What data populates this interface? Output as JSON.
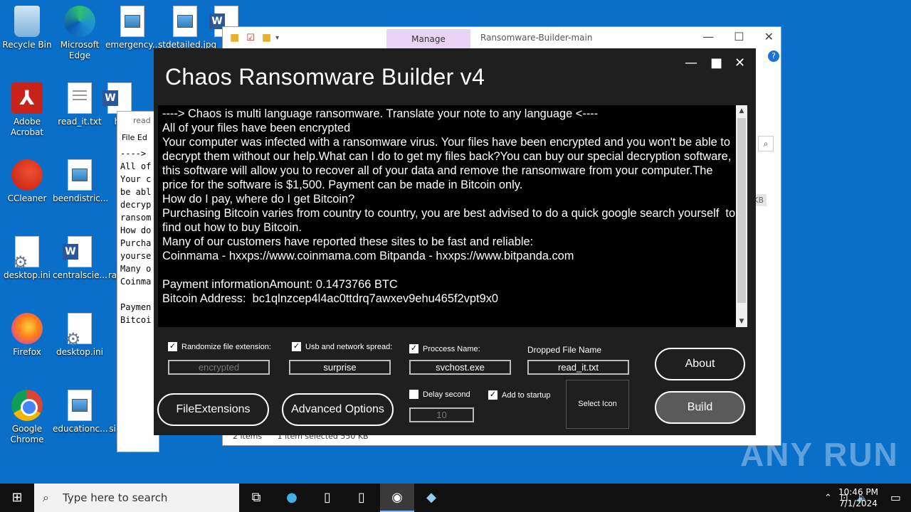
{
  "desktop": {
    "icons": [
      {
        "label": "Recycle Bin"
      },
      {
        "label": "Microsoft Edge"
      },
      {
        "label": "emergency..."
      },
      {
        "label": "stdetailed.jpg"
      },
      {
        "label": "Adobe Acrobat"
      },
      {
        "label": "read_it.txt"
      },
      {
        "label": "ha"
      },
      {
        "label": "CCleaner"
      },
      {
        "label": "beendistric..."
      },
      {
        "label": "desktop.ini"
      },
      {
        "label": "centralscie..."
      },
      {
        "label": "ra"
      },
      {
        "label": "Firefox"
      },
      {
        "label": "desktop.ini"
      },
      {
        "label": "Google Chrome"
      },
      {
        "label": "educationc..."
      },
      {
        "label": "si"
      }
    ]
  },
  "explorer": {
    "title": "Ransomware-Builder-main",
    "ribbon_tab": "Manage",
    "status_items": "2 items",
    "status_selected": "1 item selected  550 KB",
    "kb_label": "KB"
  },
  "notepad": {
    "title": "read",
    "menu": "File  Ed",
    "lines": "---->\nAll of\nYour c\nbe abl\ndecryp\nransom\nHow do\nPurcha\nyourse\nMany o\nCoinma\n\nPaymen\nBitcoi"
  },
  "chaos": {
    "title": "Chaos Ransomware Builder v4",
    "note": "----> Chaos is multi language ransomware. Translate your note to any language <----\nAll of your files have been encrypted\nYour computer was infected with a ransomware virus. Your files have been encrypted and you won't be able to decrypt them without our help.What can I do to get my files back?You can buy our special decryption software, this software will allow you to recover all of your data and remove the ransomware from your computer.The price for the software is $1,500. Payment can be made in Bitcoin only.\nHow do I pay, where do I get Bitcoin?\nPurchasing Bitcoin varies from country to country, you are best advised to do a quick google search yourself  to find out how to buy Bitcoin.\nMany of our customers have reported these sites to be fast and reliable:\nCoinmama - hxxps://www.coinmama.com Bitpanda - hxxps://www.bitpanda.com\n\nPayment informationAmount: 0.1473766 BTC\nBitcoin Address:  bc1qlnzcep4l4ac0ttdrq7awxev9ehu465f2vpt9x0",
    "options": {
      "randomize_label": "Randomize file extension:",
      "randomize_value": "encrypted",
      "usb_label": "Usb and network spread:",
      "usb_value": "surprise",
      "process_label": "Proccess Name:",
      "process_value": "svchost.exe",
      "dropped_label": "Dropped File Name",
      "dropped_value": "read_it.txt",
      "delay_label": "Delay second",
      "delay_value": "10",
      "startup_label": "Add to startup"
    },
    "buttons": {
      "file_extensions": "FileExtensions",
      "advanced_options": "Advanced Options",
      "select_icon": "Select Icon",
      "about": "About",
      "build": "Build"
    }
  },
  "taskbar": {
    "search_placeholder": "Type here to search",
    "time": "10:46 PM",
    "date": "7/1/2024"
  },
  "watermark": "ANY RUN"
}
